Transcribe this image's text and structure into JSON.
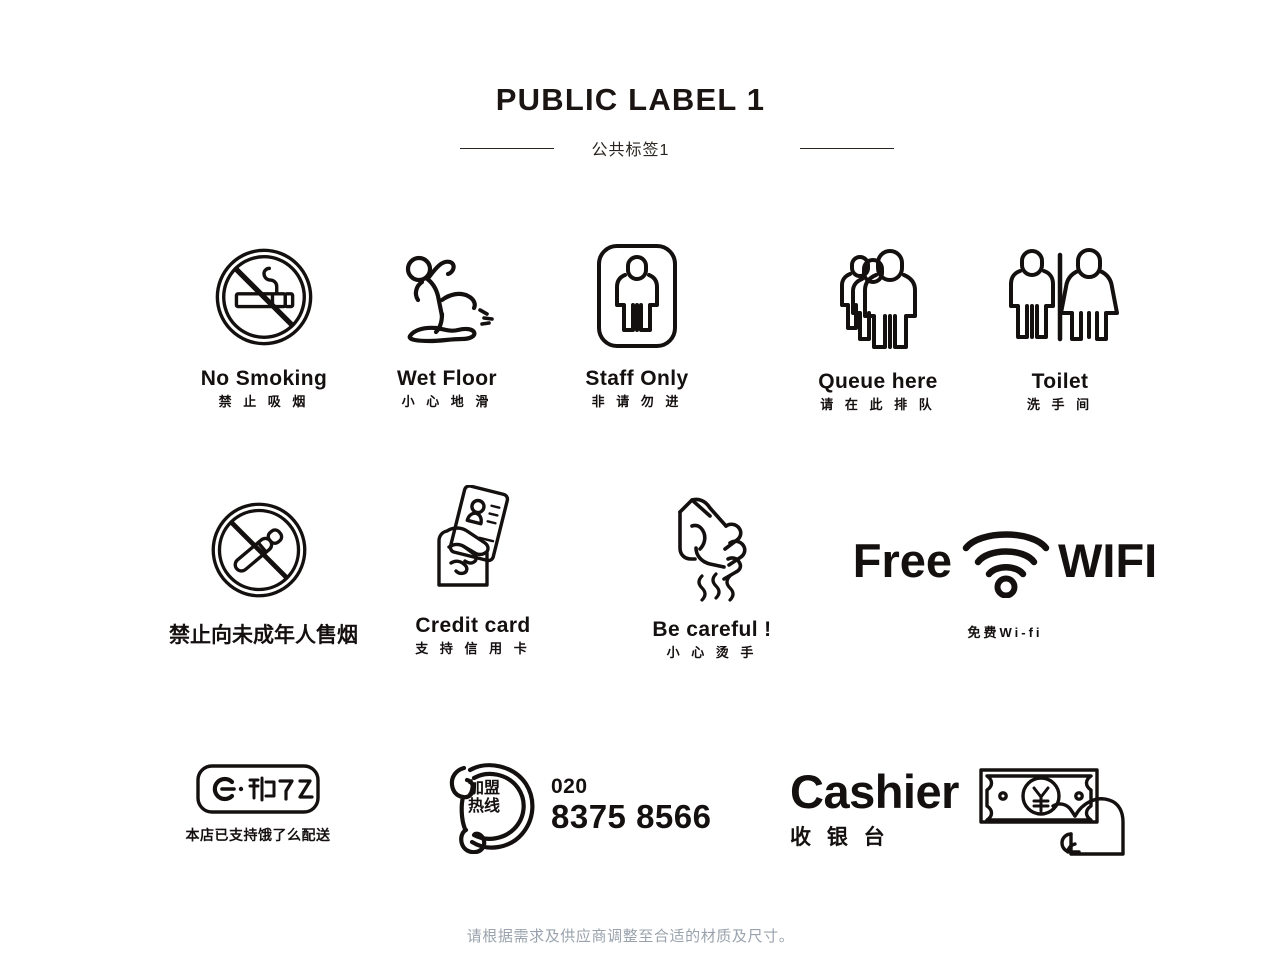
{
  "header": {
    "title": "PUBLIC LABEL 1",
    "subtitle": "公共标签1"
  },
  "rows": [
    {
      "row_id": "row-1",
      "items": [
        {
          "id": "no-smoking",
          "icon": "no-smoking-icon",
          "label_en": "No Smoking",
          "label_cn": "禁 止 吸 烟"
        },
        {
          "id": "wet-floor",
          "icon": "wet-floor-icon",
          "label_en": "Wet Floor",
          "label_cn": "小 心 地 滑"
        },
        {
          "id": "staff-only",
          "icon": "staff-only-icon",
          "label_en": "Staff Only",
          "label_cn": "非 请 勿 进"
        },
        {
          "id": "queue-here",
          "icon": "queue-here-icon",
          "label_en": "Queue here",
          "label_cn": "请 在 此 排 队"
        },
        {
          "id": "toilet",
          "icon": "toilet-icon",
          "label_en": "Toilet",
          "label_cn": "洗 手 间"
        }
      ]
    },
    {
      "row_id": "row-2",
      "items": [
        {
          "id": "no-tobacco-minors",
          "icon": "no-cigarette-circle-icon",
          "label_en": "",
          "label_cn": "禁止向未成年人售烟"
        },
        {
          "id": "credit-card",
          "icon": "hand-credit-card-icon",
          "label_en": "Credit card",
          "label_cn": "支 持 信 用 卡"
        },
        {
          "id": "be-careful",
          "icon": "hot-hand-icon",
          "label_en": "Be careful !",
          "label_cn": "小 心 烫 手"
        },
        {
          "id": "free-wifi",
          "icon": "wifi-icon",
          "label_left": "Free",
          "label_right": "WIFI",
          "label_cn": "免费Wi-fi"
        }
      ]
    },
    {
      "row_id": "row-3",
      "items": [
        {
          "id": "eleme-delivery",
          "icon": "eleme-logo-icon",
          "label_cn": "本店已支持饿了么配送"
        },
        {
          "id": "hotline",
          "icon": "phone-handset-icon",
          "icon_text_line1": "加盟",
          "icon_text_line2": "热线",
          "area_code": "020",
          "number": "8375 8566"
        },
        {
          "id": "cashier",
          "icon": "hand-banknote-icon",
          "label_en": "Cashier",
          "label_cn": "收 银 台"
        }
      ]
    }
  ],
  "footer": {
    "note": "请根据需求及供应商调整至合适的材质及尺寸。"
  },
  "colors": {
    "ink": "#151010",
    "subtle": "#9aa3ad",
    "background": "#ffffff"
  }
}
